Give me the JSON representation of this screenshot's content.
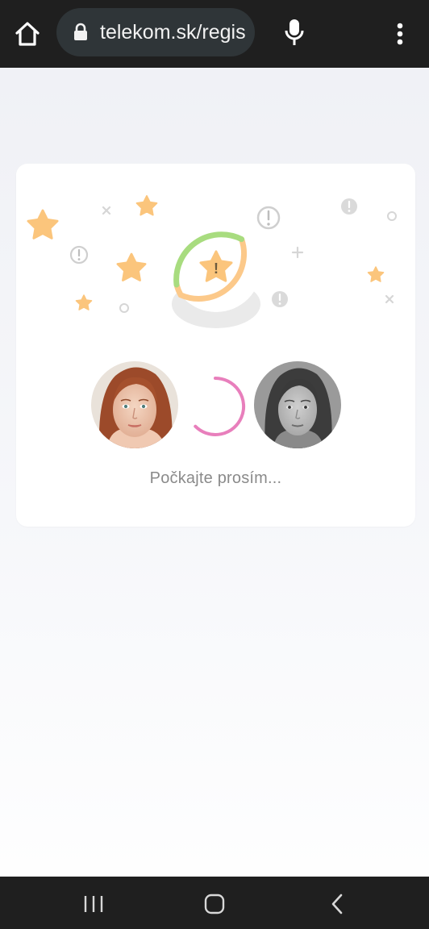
{
  "browser": {
    "url": "telekom.sk/regis",
    "icons": {
      "home": "home-icon",
      "lock": "lock-icon",
      "mic": "microphone-icon",
      "menu": "more-vertical-icon"
    }
  },
  "verification": {
    "status_text": "Počkajte prosím...",
    "badge_symbol": "!",
    "colors": {
      "progress_green": "#a8dc7f",
      "progress_orange": "#fcc98a",
      "star": "#fbc57c",
      "spinner": "#e87fbc",
      "muted_icon": "#cfcfcf"
    },
    "faces": [
      {
        "name": "selfie-photo",
        "tone": "color"
      },
      {
        "name": "document-photo",
        "tone": "grayscale"
      }
    ]
  },
  "system_nav": {
    "icons": {
      "recent": "recent-apps-icon",
      "home": "nav-home-icon",
      "back": "back-icon"
    }
  }
}
